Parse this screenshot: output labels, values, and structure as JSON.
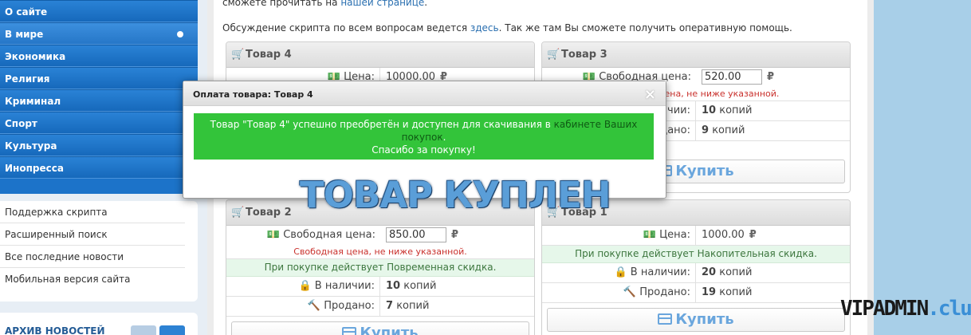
{
  "sidebar": {
    "menu": [
      "О сайте",
      "В мире",
      "Экономика",
      "Религия",
      "Криминал",
      "Спорт",
      "Культура",
      "Инопресса"
    ],
    "links": [
      "Поддержка скрипта",
      "Расширенный поиск",
      "Все последние новости",
      "Мобильная версия сайта"
    ],
    "archive_title": "АРХИВ НОВОСТЕЙ"
  },
  "content": {
    "intro_text": "сможете прочитать на",
    "intro_link": "нашей странице",
    "intro_end": ".",
    "discussion_text": "Обсуждение скрипта по всем вопросам ведется",
    "discussion_link": "здесь",
    "discussion_end": ". Так же там Вы сможете получить оперативную помощь."
  },
  "cards": {
    "c4": {
      "title": "Товар 4",
      "price_label": "Цена:",
      "price": "10000.00"
    },
    "c3": {
      "title": "Товар 3",
      "price_label": "Свободная цена:",
      "price_input": "520.00",
      "note": "цена, не ниже указанной.",
      "stock_label": "чии:",
      "stock": "10",
      "stock_unit": "копий",
      "sold_label": "дано:",
      "sold": "9",
      "sold_unit": "копий",
      "buy": "Купить"
    },
    "c2": {
      "title": "Товар 2",
      "price_label": "Свободная цена:",
      "price_input": "850.00",
      "note": "Свободная цена, не ниже указанной.",
      "discount": "При покупке действует Повременная скидка.",
      "stock_label": "В наличии:",
      "stock": "10",
      "stock_unit": "копий",
      "sold_label": "Продано:",
      "sold": "7",
      "sold_unit": "копий",
      "buy": "Купить"
    },
    "c1": {
      "title": "Товар 1",
      "price_label": "Цена:",
      "price": "1000.00",
      "discount": "При покупке действует Накопительная скидка.",
      "stock_label": "В наличии:",
      "stock": "20",
      "stock_unit": "копий",
      "sold_label": "Продано:",
      "sold": "19",
      "sold_unit": "копий",
      "buy": "Купить"
    },
    "currency": "₽"
  },
  "modal": {
    "title": "Оплата товара: Товар 4",
    "close": "×",
    "msg_start": "Товар \"Товар 4\" успешно преобретён и доступен для скачивания в",
    "msg_link": "кабинете Ваших покупок",
    "msg_end": ".",
    "thanks": "Спасибо за покупку!"
  },
  "overlay": {
    "bought_text": "ТОВАР КУПЛЕН",
    "watermark_main": "VIPADMIN",
    "watermark_tld": ".club"
  },
  "icons": {
    "cart": "shopping-cart-icon",
    "money": "money-icon",
    "lock": "lock-icon",
    "gavel": "gavel-icon",
    "card": "credit-card-icon",
    "dot": "active-dot-icon"
  },
  "colors": {
    "menu_blue": "#1c73c9",
    "success_green": "#33c43a",
    "link_blue": "#2a6fb0",
    "warning_red": "#c9302c",
    "discount_bg": "#e6f7ea"
  }
}
